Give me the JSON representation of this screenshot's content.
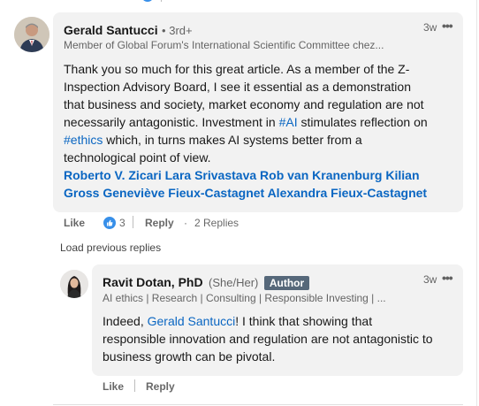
{
  "comment": {
    "author_name": "Gerald Santucci",
    "degree": "• 3rd+",
    "headline": "Member of Global Forum's International Scientific Committee chez...",
    "timestamp": "3w",
    "more_label": "•••",
    "body_lines": [
      "Thank you so much for this great article. As a member of the Z-",
      "Inspection Advisory Board, I see it essential as a demonstration",
      "that business and society, market economy and regulation are not",
      "necessarily antagonistic. Investment in"
    ],
    "hashtag_ai": "#AI",
    "after_ai": " stimulates reflection on",
    "hashtag_ethics": "#ethics",
    "after_ethics": " which, in turns makes AI systems better from a",
    "last_line": "technological point of view.",
    "mentions_line1": "Roberto V. Zicari Lara Srivastava Rob van Kranenburg Kilian",
    "mentions_line2": "Gross Geneviève Fieux-Castagnet Alexandra Fieux-Castagnet",
    "actions": {
      "like": "Like",
      "like_count": "3",
      "reply": "Reply",
      "replies": "2 Replies",
      "dot": "·"
    }
  },
  "load_previous": "Load previous replies",
  "reply": {
    "author_name": "Ravit Dotan, PhD",
    "pronouns": "(She/Her)",
    "author_badge": "Author",
    "headline": "AI ethics | Research | Consulting | Responsible Investing | ...",
    "timestamp": "3w",
    "more_label": "•••",
    "prefix": "Indeed, ",
    "mention": "Gerald Santucci",
    "rest_line1": "! I think that showing that",
    "line2": "responsible innovation and regulation are not antagonistic to",
    "line3": "business growth can be pivotal.",
    "actions": {
      "like": "Like",
      "reply": "Reply"
    }
  },
  "colors": {
    "link": "#0a66c2",
    "bubble": "#f2f2f2",
    "badge": "#56687a"
  }
}
